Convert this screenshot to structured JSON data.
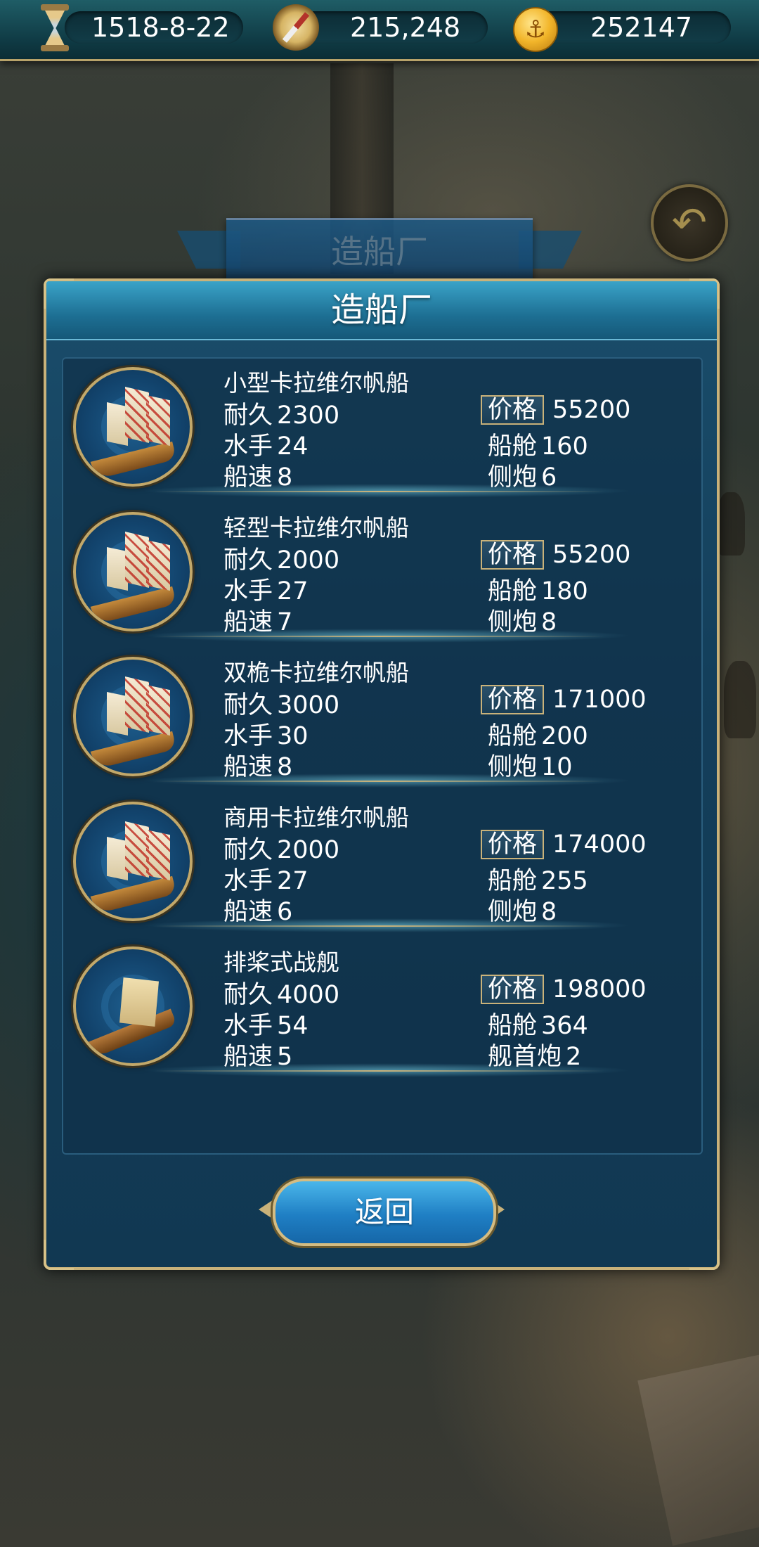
{
  "topbar": {
    "date": "1518-8-22",
    "fame": "215,248",
    "gold": "252147",
    "gold_icon": "⚓"
  },
  "back_icon": "↶",
  "banner_title": "造船厂",
  "dialog": {
    "title": "造船厂",
    "return_label": "返回"
  },
  "ships": [
    {
      "name": "小型卡拉维尔帆船",
      "durability_label": "耐久",
      "durability": "2300",
      "crew_label": "水手",
      "crew": "24",
      "speed_label": "船速",
      "speed": "8",
      "price_label": "价格",
      "price": "55200",
      "cargo_label": "船舱",
      "cargo": "160",
      "cannon_label": "侧炮",
      "cannon": "6"
    },
    {
      "name": "轻型卡拉维尔帆船",
      "durability_label": "耐久",
      "durability": "2000",
      "crew_label": "水手",
      "crew": "27",
      "speed_label": "船速",
      "speed": "7",
      "price_label": "价格",
      "price": "55200",
      "cargo_label": "船舱",
      "cargo": "180",
      "cannon_label": "侧炮",
      "cannon": "8"
    },
    {
      "name": "双桅卡拉维尔帆船",
      "durability_label": "耐久",
      "durability": "3000",
      "crew_label": "水手",
      "crew": "30",
      "speed_label": "船速",
      "speed": "8",
      "price_label": "价格",
      "price": "171000",
      "cargo_label": "船舱",
      "cargo": "200",
      "cannon_label": "侧炮",
      "cannon": "10"
    },
    {
      "name": "商用卡拉维尔帆船",
      "durability_label": "耐久",
      "durability": "2000",
      "crew_label": "水手",
      "crew": "27",
      "speed_label": "船速",
      "speed": "6",
      "price_label": "价格",
      "price": "174000",
      "cargo_label": "船舱",
      "cargo": "255",
      "cannon_label": "侧炮",
      "cannon": "8"
    },
    {
      "name": "排桨式战舰",
      "durability_label": "耐久",
      "durability": "4000",
      "crew_label": "水手",
      "crew": "54",
      "speed_label": "船速",
      "speed": "5",
      "price_label": "价格",
      "price": "198000",
      "cargo_label": "船舱",
      "cargo": "364",
      "cannon_label": "舰首炮",
      "cannon": "2"
    }
  ]
}
